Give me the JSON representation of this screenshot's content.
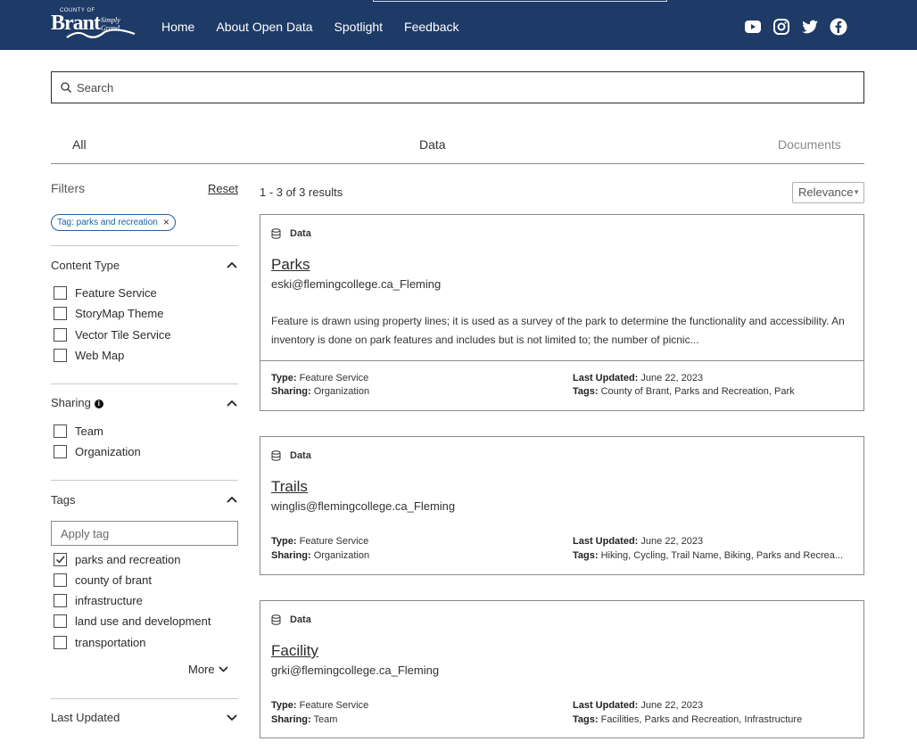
{
  "header": {
    "logo": {
      "county": "COUNTY OF",
      "brand": "Brant",
      "tagline": "Simply Grand"
    },
    "nav": [
      "Home",
      "About Open Data",
      "Spotlight",
      "Feedback"
    ],
    "social_icons": [
      "youtube-icon",
      "instagram-icon",
      "twitter-icon",
      "facebook-icon"
    ],
    "bg_color": "#1e3a66"
  },
  "search": {
    "placeholder": "Search"
  },
  "tabs": [
    "All",
    "Data",
    "Documents"
  ],
  "filters": {
    "title": "Filters",
    "reset": "Reset",
    "active_chip": "Tag: parks and recreation",
    "content_type": {
      "title": "Content Type",
      "options": [
        {
          "label": "Feature Service",
          "checked": false
        },
        {
          "label": "StoryMap Theme",
          "checked": false
        },
        {
          "label": "Vector Tile Service",
          "checked": false
        },
        {
          "label": "Web Map",
          "checked": false
        }
      ]
    },
    "sharing": {
      "title": "Sharing",
      "options": [
        {
          "label": "Team",
          "checked": false
        },
        {
          "label": "Organization",
          "checked": false
        }
      ]
    },
    "tags": {
      "title": "Tags",
      "input_placeholder": "Apply tag",
      "options": [
        {
          "label": "parks and recreation",
          "checked": true
        },
        {
          "label": "county of brant",
          "checked": false
        },
        {
          "label": "infrastructure",
          "checked": false
        },
        {
          "label": "land use and development",
          "checked": false
        },
        {
          "label": "transportation",
          "checked": false
        }
      ],
      "more": "More"
    },
    "last_updated": {
      "title": "Last Updated"
    }
  },
  "results": {
    "count": "1 - 3 of 3 results",
    "sort": "Relevance",
    "items": [
      {
        "kind": "Data",
        "title": "Parks",
        "owner": "eski@flemingcollege.ca_Fleming",
        "description": "Feature is drawn using property lines; it is used as a survey of the park to determine the functionality and accessibility. An inventory is done on park features and includes but is not limited to; the number of picnic...",
        "type_label": "Type:",
        "type": "Feature Service",
        "sharing_label": "Sharing:",
        "sharing": "Organization",
        "updated_label": "Last Updated:",
        "updated": "June 22, 2023",
        "tags_label": "Tags:",
        "tags": "County of Brant, Parks and Recreation, Park"
      },
      {
        "kind": "Data",
        "title": "Trails",
        "owner": "winglis@flemingcollege.ca_Fleming",
        "description": "",
        "type_label": "Type:",
        "type": "Feature Service",
        "sharing_label": "Sharing:",
        "sharing": "Organization",
        "updated_label": "Last Updated:",
        "updated": "June 22, 2023",
        "tags_label": "Tags:",
        "tags": "Hiking, Cycling, Trail Name, Biking, Parks and Recrea..."
      },
      {
        "kind": "Data",
        "title": "Facility",
        "owner": "grki@flemingcollege.ca_Fleming",
        "description": "",
        "type_label": "Type:",
        "type": "Feature Service",
        "sharing_label": "Sharing:",
        "sharing": "Team",
        "updated_label": "Last Updated:",
        "updated": "June 22, 2023",
        "tags_label": "Tags:",
        "tags": "Facilities, Parks and Recreation, Infrastructure"
      }
    ]
  }
}
